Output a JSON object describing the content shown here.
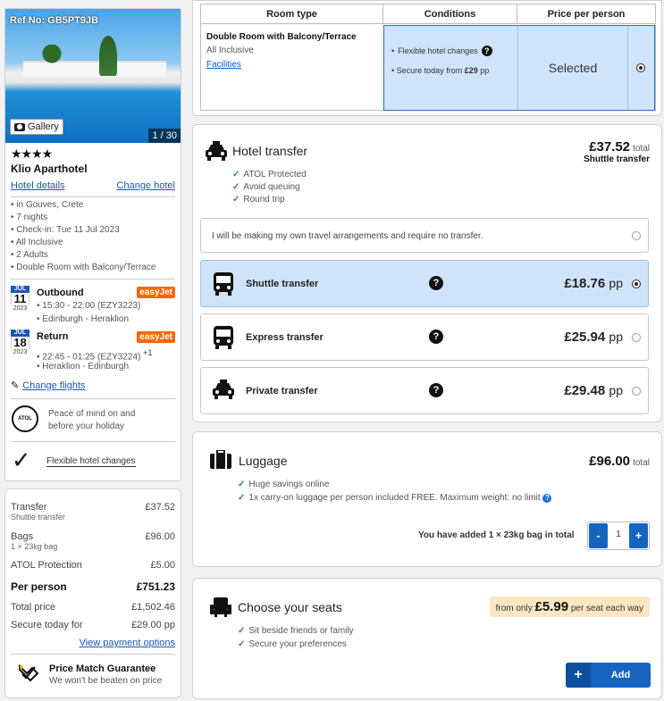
{
  "sidebar": {
    "ref": "Ref No: GB5PT9JB",
    "gallery_label": "Gallery",
    "gallery_count": "1 / 30",
    "stars": "★★★★",
    "hotel_name": "Klio Aparthotel",
    "hotel_details": "Hotel details",
    "change_hotel": "Change hotel",
    "bullets": [
      "in Gouves, Crete",
      "7 nights",
      "Check-in: Tue 11 Jul 2023",
      "All Inclusive",
      "2 Adults",
      "Double Room with Balcony/Terrace"
    ],
    "outbound": {
      "month": "JUL",
      "day": "11",
      "year": "2023",
      "title": "Outbound",
      "airline": "easyJet",
      "time": "15:30 - 22:00 (EZY3223)",
      "route": "Edinburgh - Heraklion"
    },
    "return": {
      "month": "JUL",
      "day": "18",
      "year": "2023",
      "title": "Return",
      "airline": "easyJet",
      "time": "22:45 - 01:25 (EZY3224)",
      "plus": "+1",
      "route": "Heraklion - Edinburgh"
    },
    "change_flights": "Change flights",
    "peace_text": "Peace of mind on and before your holiday",
    "flexible": "Flexible hotel changes"
  },
  "summary": {
    "transfer_label": "Transfer",
    "transfer_sub": "Shuttle transfer",
    "transfer_value": "£37.52",
    "bags_label": "Bags",
    "bags_sub": "1 × 23kg bag",
    "bags_value": "£96.00",
    "atol_label": "ATOL Protection",
    "atol_value": "£5.00",
    "per_person_label": "Per person",
    "per_person_value": "£751.23",
    "total_label": "Total price",
    "total_value": "£1,502.46",
    "secure_label": "Secure today for",
    "secure_value": "£29.00 pp",
    "view_payment": "View payment options",
    "pmg_title": "Price Match Guarantee",
    "pmg_sub": "We won't be beaten on price"
  },
  "room": {
    "headers": [
      "Room type",
      "Conditions",
      "Price per person"
    ],
    "name": "Double Room with Balcony/Terrace",
    "board": "All Inclusive",
    "facilities": "Facilities",
    "cond1": "Flexible hotel changes",
    "cond2_prefix": "Secure today from",
    "cond2_amount": "£29",
    "cond2_suffix": "pp",
    "price_state": "Selected"
  },
  "transfer": {
    "title": "Hotel transfer",
    "total": "£37.52",
    "total_word": "total",
    "total_sub": "Shuttle transfer",
    "features": [
      "ATOL Protected",
      "Avoid queuing",
      "Round trip"
    ],
    "own_arrangements": "I will be making my own travel arrangements and require no transfer.",
    "options": [
      {
        "label": "Shuttle transfer",
        "price": "£18.76",
        "unit": "pp",
        "selected": true
      },
      {
        "label": "Express transfer",
        "price": "£25.94",
        "unit": "pp",
        "selected": false
      },
      {
        "label": "Private transfer",
        "price": "£29.48",
        "unit": "pp",
        "selected": false
      }
    ]
  },
  "luggage": {
    "title": "Luggage",
    "total": "£96.00",
    "total_word": "total",
    "features": [
      "Huge savings online",
      "1x carry-on luggage per person included FREE. Maximum weight: no limit"
    ],
    "added_text": "You have added 1 × 23kg bag in total",
    "qty": "1",
    "minus": "-",
    "plus": "+"
  },
  "seats": {
    "title": "Choose your seats",
    "from_only": "from only",
    "price": "£5.99",
    "per_seat": "per seat each way",
    "features": [
      "Sit beside friends or family",
      "Secure your preferences"
    ],
    "add_label": "Add",
    "add_plus": "+"
  },
  "colors": {
    "accent": "#1a57b8",
    "selected_bg": "#cfe4fb",
    "check": "#2e8b3d",
    "easyjet": "#ff6600",
    "button": "#1565c0"
  }
}
